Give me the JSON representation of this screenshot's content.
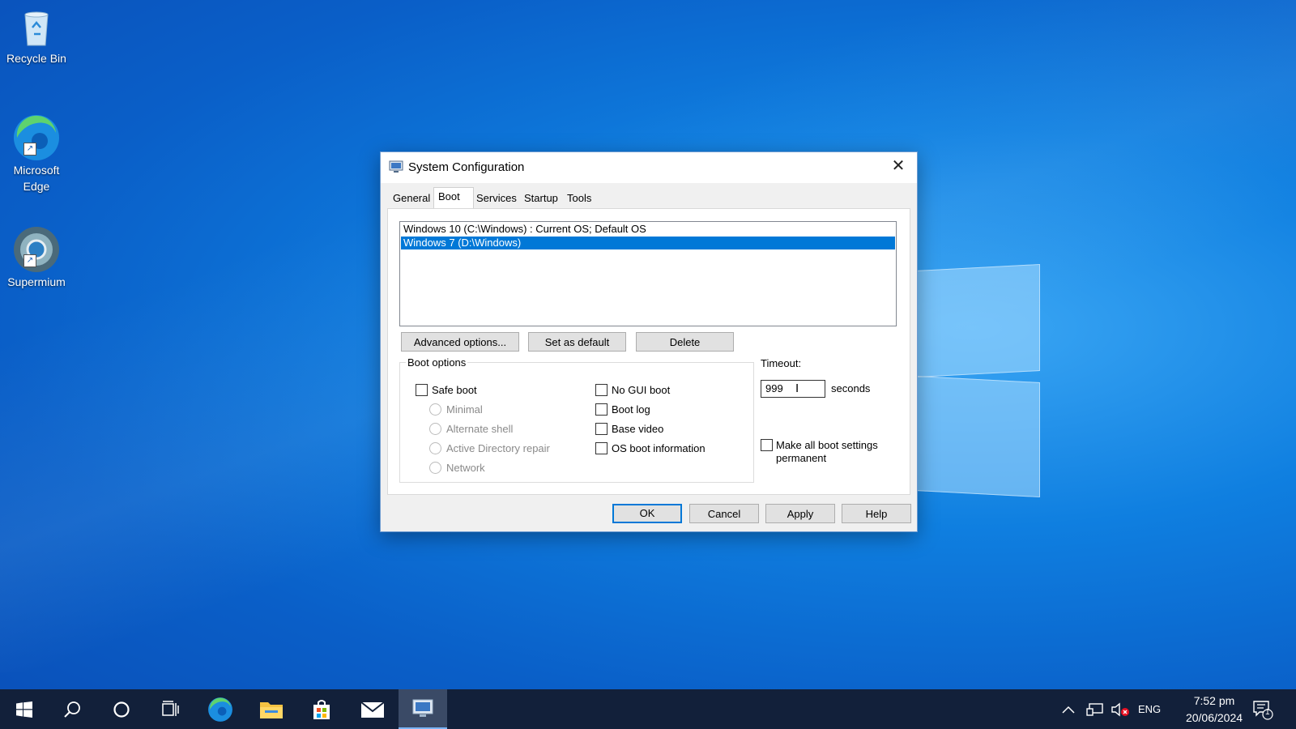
{
  "desktop": {
    "icons": [
      {
        "label": "Recycle Bin"
      },
      {
        "label": "Microsoft Edge"
      },
      {
        "label": "Supermium"
      }
    ]
  },
  "dialog": {
    "title": "System Configuration",
    "close_glyph": "✕",
    "tabs": [
      "General",
      "Boot",
      "Services",
      "Startup",
      "Tools"
    ],
    "active_tab": "Boot",
    "os_entries": [
      {
        "label": "Windows 10 (C:\\Windows) : Current OS; Default OS",
        "selected": false
      },
      {
        "label": "Windows 7 (D:\\Windows)",
        "selected": true
      }
    ],
    "buttons": {
      "advanced": "Advanced options...",
      "set_default": "Set as default",
      "delete": "Delete"
    },
    "boot_options": {
      "label": "Boot options",
      "safe_boot": "Safe boot",
      "radios": [
        "Minimal",
        "Alternate shell",
        "Active Directory repair",
        "Network"
      ],
      "checks": [
        "No GUI boot",
        "Boot log",
        "Base video",
        "OS boot information"
      ]
    },
    "timeout": {
      "label": "Timeout:",
      "value": "999",
      "unit": "seconds"
    },
    "permanent": {
      "line1": "Make all boot settings",
      "line2": "permanent"
    },
    "footer": {
      "ok": "OK",
      "cancel": "Cancel",
      "apply": "Apply",
      "help": "Help"
    }
  },
  "taskbar": {
    "language": "ENG",
    "time": "7:52 pm",
    "date": "20/06/2024",
    "notification_count": "1"
  },
  "colors": {
    "selection": "#0078d7",
    "taskbar": "#12203a"
  }
}
